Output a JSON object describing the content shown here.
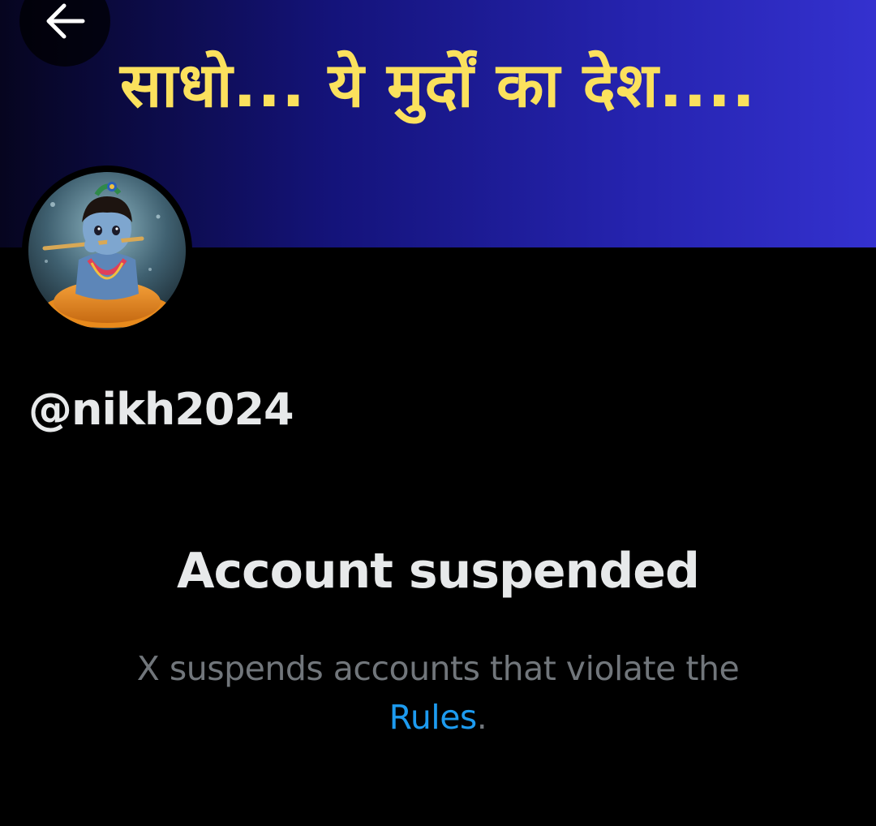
{
  "banner": {
    "text": "साधो... ये मुर्दों का देश....",
    "gradient_colors": [
      "#06051f",
      "#14137a",
      "#2523ae",
      "#3431cf"
    ],
    "text_color": "#fbe15d"
  },
  "back_button": {
    "icon": "arrow-left-icon"
  },
  "profile": {
    "avatar_subject": "child-with-flute-avatar",
    "handle": "@nikh2024"
  },
  "suspension": {
    "title": "Account suspended",
    "message": "X suspends accounts that violate the",
    "link_text": "Rules",
    "message_end": ".",
    "link_color": "#1d9bf0"
  },
  "colors": {
    "background": "#000000",
    "primary_text": "#e7e9ea",
    "secondary_text": "#71767b"
  }
}
